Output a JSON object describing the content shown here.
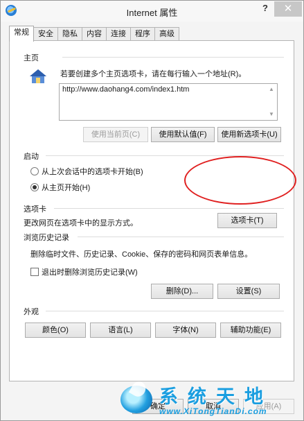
{
  "window": {
    "title": "Internet 属性",
    "help": "?",
    "close": "✕"
  },
  "tabs": [
    "常规",
    "安全",
    "隐私",
    "内容",
    "连接",
    "程序",
    "高级"
  ],
  "home_page": {
    "title": "主页",
    "description": "若要创建多个主页选项卡，请在每行输入一个地址(R)。",
    "url": "http://www.daohang4.com/index1.htm",
    "buttons": {
      "use_current": "使用当前页(C)",
      "use_default": "使用默认值(F)",
      "use_new_tab": "使用新选项卡(U)"
    }
  },
  "startup": {
    "title": "启动",
    "options": [
      "从上次会话中的选项卡开始(B)",
      "从主页开始(H)"
    ],
    "selected": 1
  },
  "tabs_section": {
    "title": "选项卡",
    "description": "更改网页在选项卡中的显示方式。",
    "button": "选项卡(T)"
  },
  "history": {
    "title": "浏览历史记录",
    "description": "删除临时文件、历史记录、Cookie、保存的密码和网页表单信息。",
    "checkbox": "退出时删除浏览历史记录(W)",
    "checked": false,
    "delete": "删除(D)...",
    "settings": "设置(S)"
  },
  "appearance": {
    "title": "外观",
    "buttons": [
      "颜色(O)",
      "语言(L)",
      "字体(N)",
      "辅助功能(E)"
    ]
  },
  "footer": {
    "ok": "确定",
    "cancel": "取消",
    "apply": "应用(A)"
  },
  "watermark": {
    "text": "系统天地",
    "url": "www.XiTongTianDi.com"
  },
  "colors": {
    "annotation": "#e02020",
    "watermark": "#1a9ee0"
  }
}
